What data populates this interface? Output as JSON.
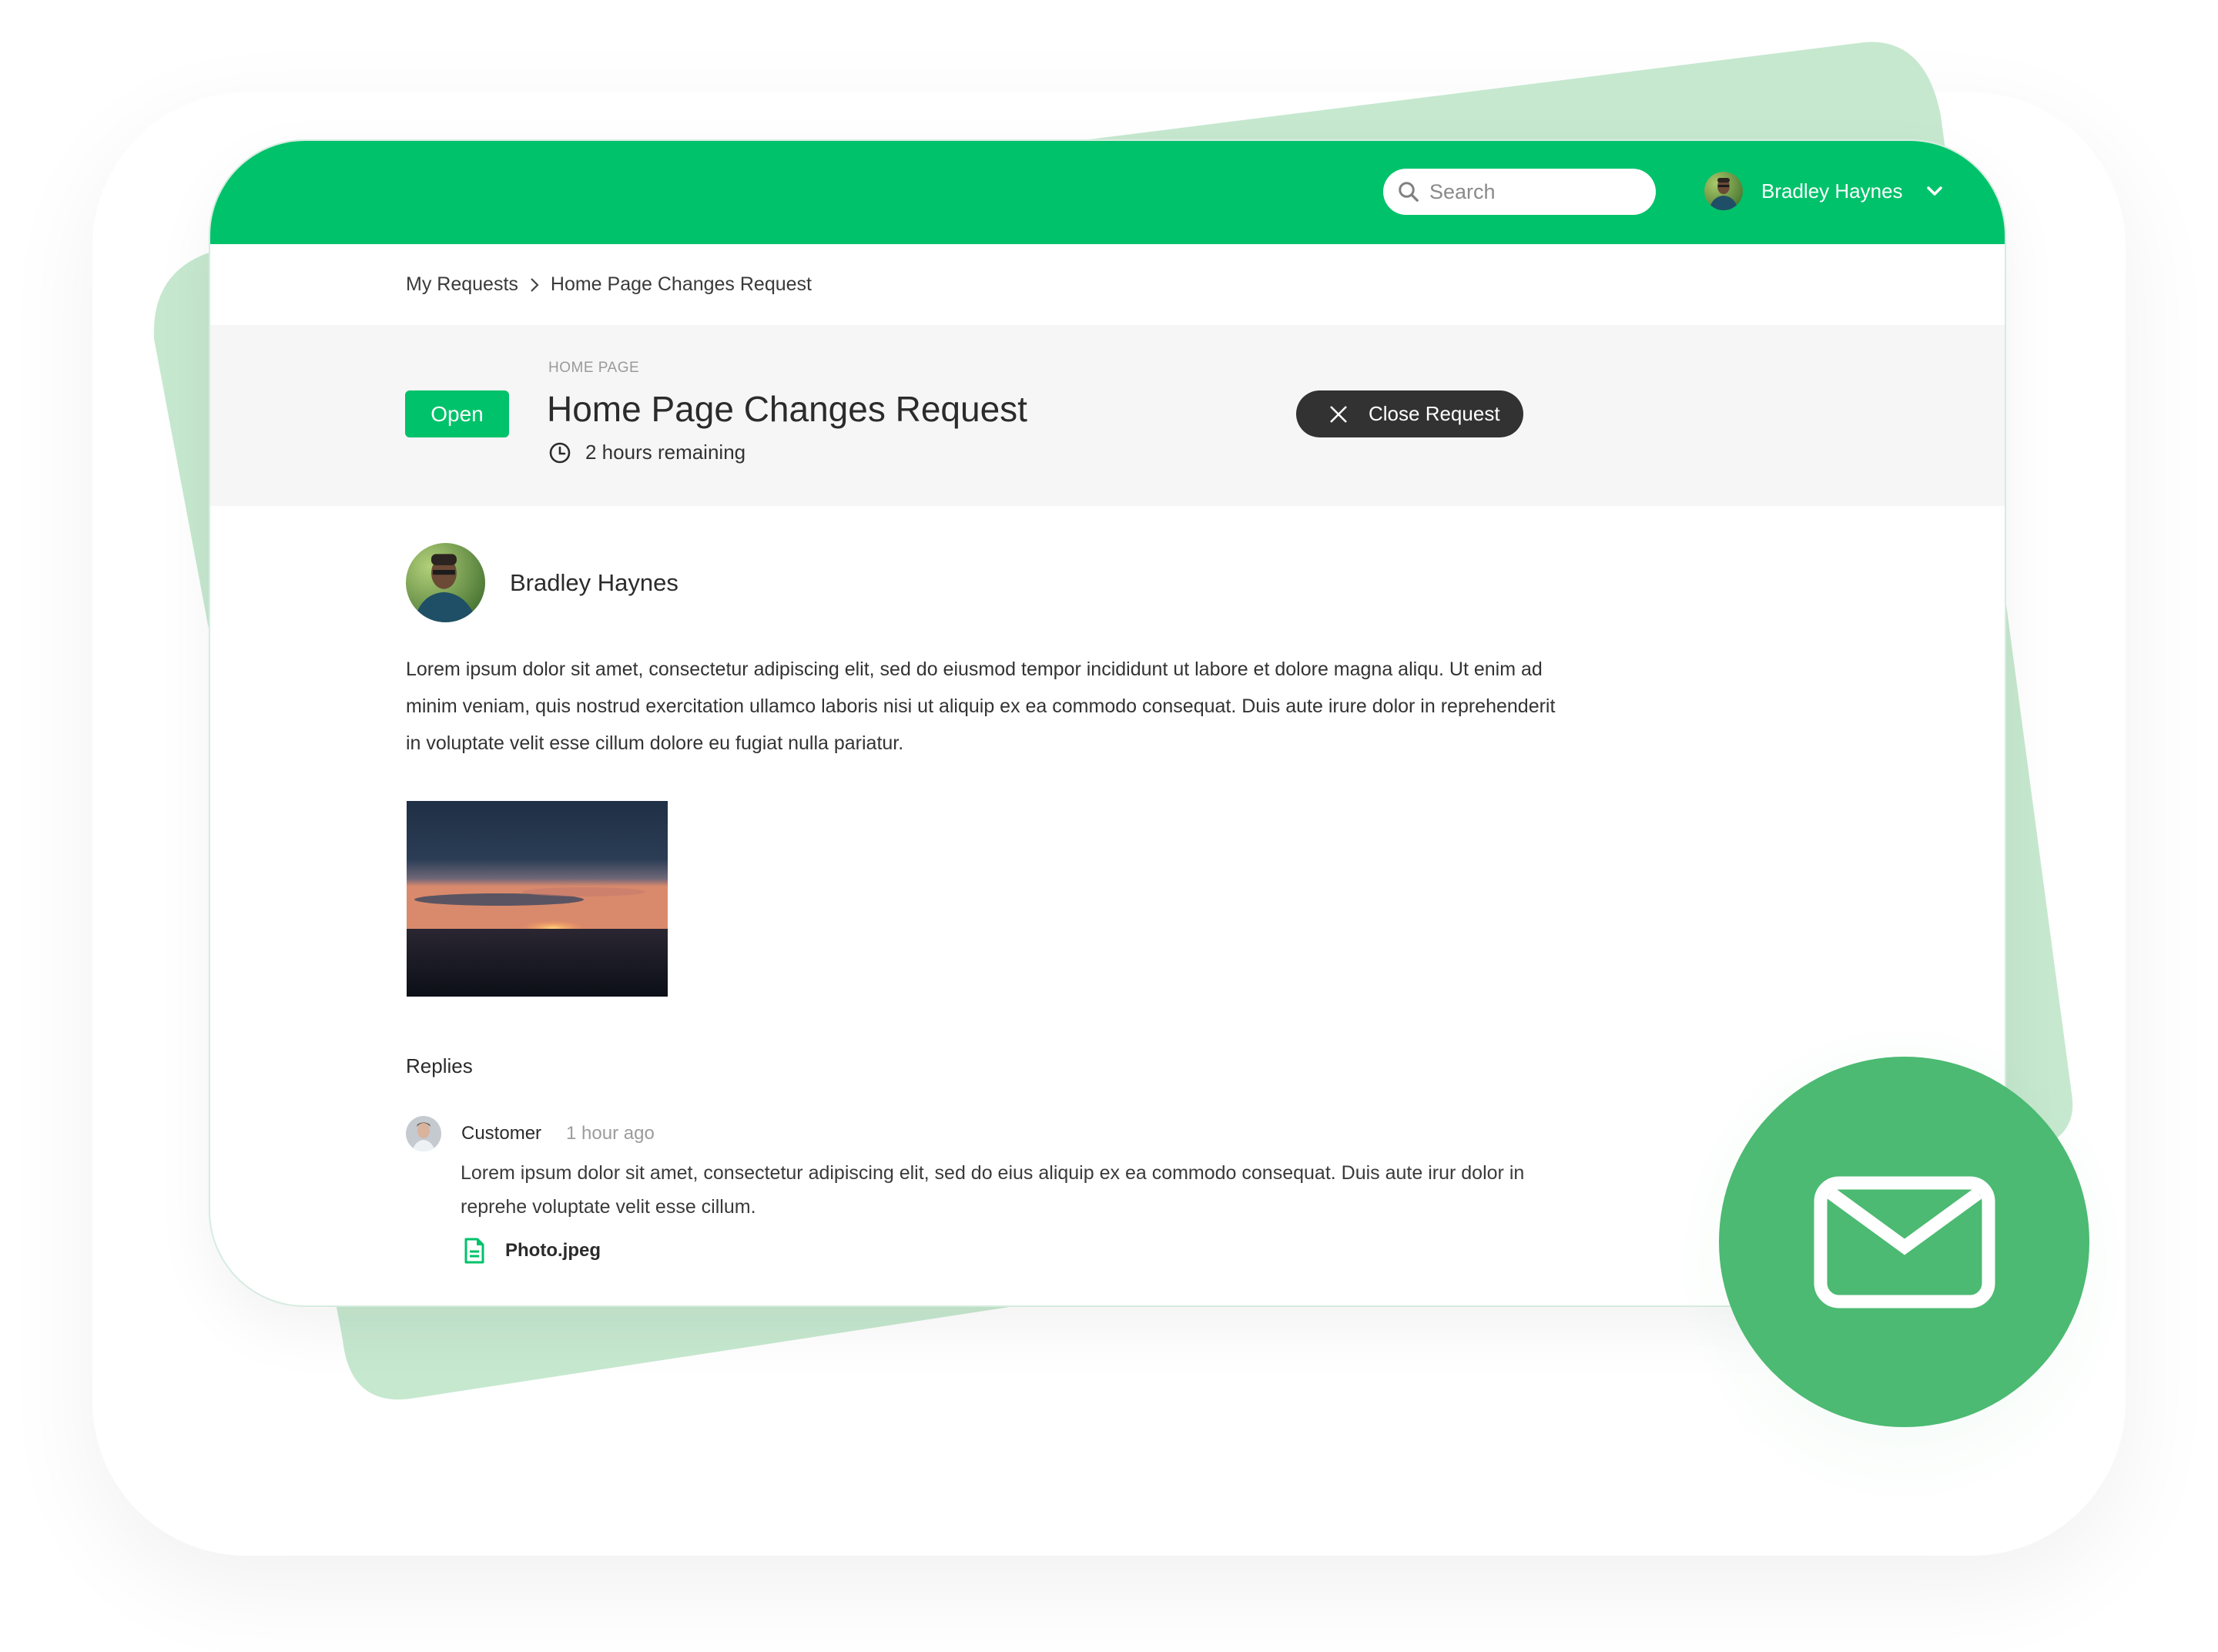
{
  "header": {
    "search_placeholder": "Search",
    "user_name": "Bradley Haynes"
  },
  "breadcrumb": {
    "items": [
      "My Requests",
      "Home Page Changes Request"
    ]
  },
  "request": {
    "status": "Open",
    "category": "HOME PAGE",
    "title": "Home Page Changes Request",
    "time_remaining": "2 hours remaining",
    "close_label": "Close Request"
  },
  "post": {
    "author": "Bradley Haynes",
    "body": "Lorem ipsum dolor sit amet, consectetur adipiscing elit, sed do eiusmod tempor incididunt ut labore et dolore magna aliqu. Ut enim ad minim veniam, quis nostrud exercitation ullamco laboris nisi ut aliquip ex ea commodo consequat. Duis aute irure dolor in reprehenderit in voluptate velit esse cillum dolore eu fugiat nulla pariatur."
  },
  "replies": {
    "heading": "Replies",
    "items": [
      {
        "author": "Customer",
        "time": "1 hour ago",
        "text": "Lorem ipsum dolor sit amet, consectetur adipiscing elit, sed do eius aliquip ex ea commodo consequat. Duis aute irur dolor in reprehe voluptate velit esse cillum.",
        "attachment": "Photo.jpeg"
      }
    ]
  },
  "colors": {
    "brand_green": "#00c26a",
    "mail_green": "#4cba72",
    "back_shape": "#c6e8cf",
    "dark_button": "#323232"
  },
  "icons": {
    "search": "search-icon",
    "chevron": "chevron-down-icon",
    "clock": "clock-icon",
    "close": "close-icon",
    "file": "file-icon",
    "mail": "mail-icon"
  }
}
